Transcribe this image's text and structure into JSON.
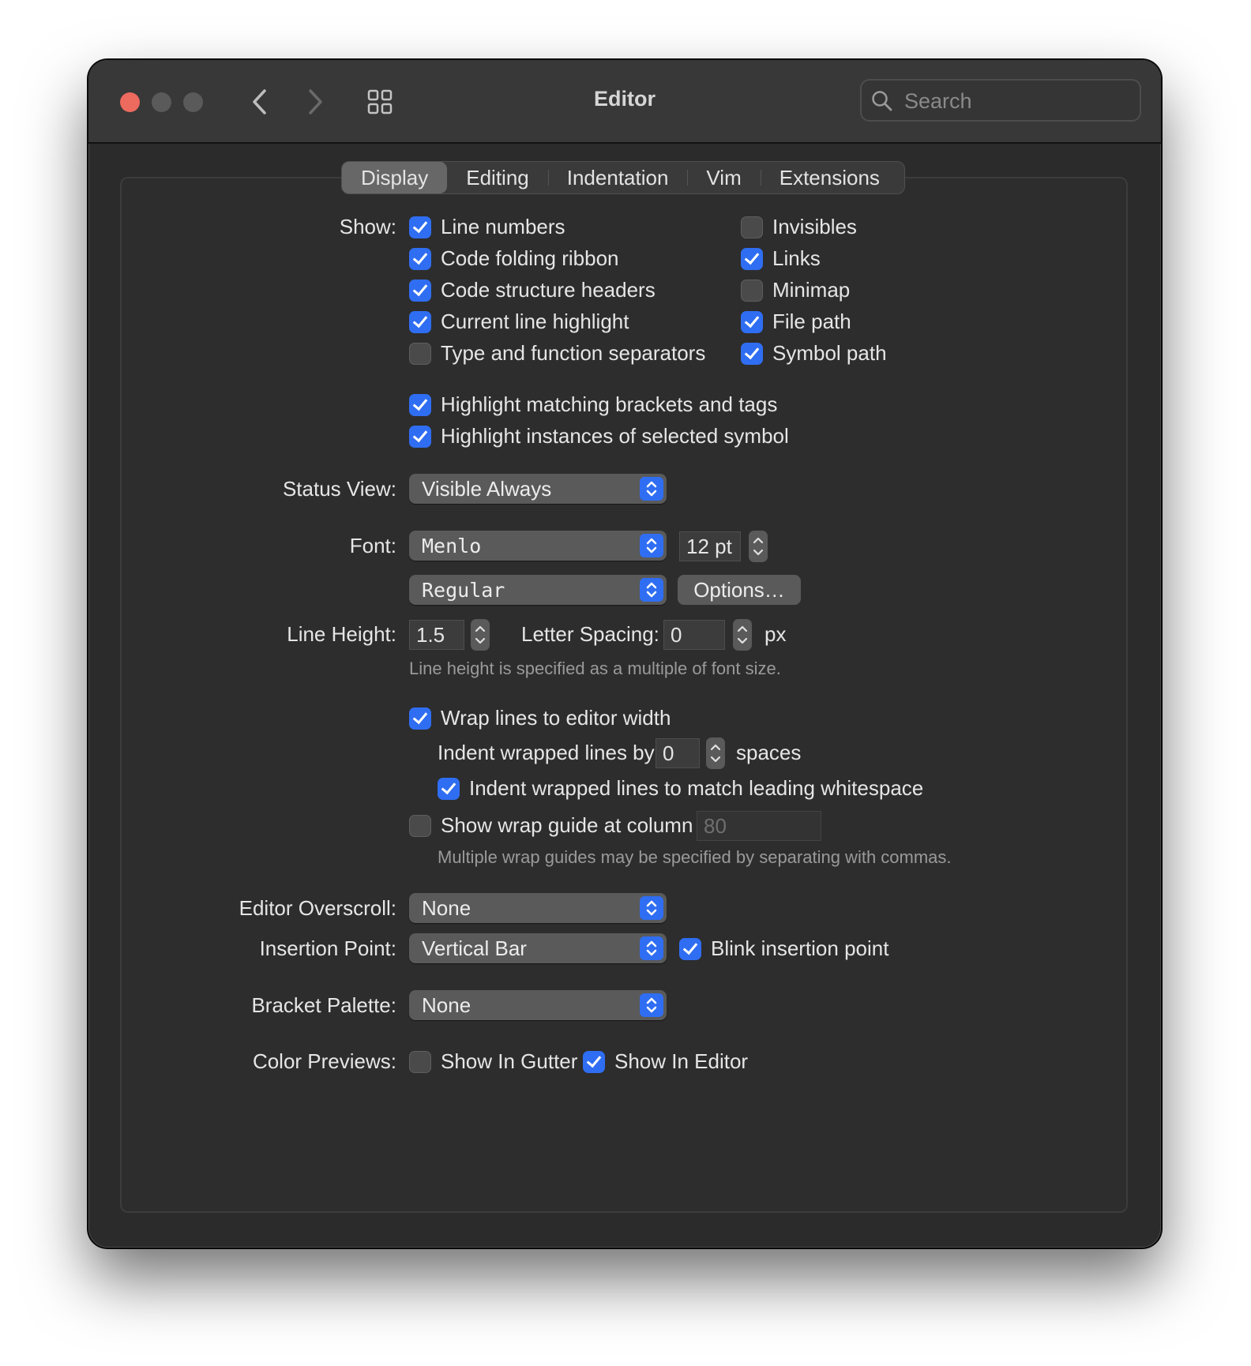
{
  "window": {
    "title": "Editor",
    "search_placeholder": "Search"
  },
  "toolbar": {
    "back_icon": "chevron-left-icon",
    "forward_icon": "chevron-right-icon",
    "grid_icon": "grid-icon"
  },
  "tabs": [
    {
      "label": "Display",
      "active": true
    },
    {
      "label": "Editing",
      "active": false
    },
    {
      "label": "Indentation",
      "active": false
    },
    {
      "label": "Vim",
      "active": false
    },
    {
      "label": "Extensions",
      "active": false
    }
  ],
  "show": {
    "label": "Show:",
    "left": [
      {
        "label": "Line numbers",
        "checked": true
      },
      {
        "label": "Code folding ribbon",
        "checked": true
      },
      {
        "label": "Code structure headers",
        "checked": true
      },
      {
        "label": "Current line highlight",
        "checked": true
      },
      {
        "label": "Type and function separators",
        "checked": false
      }
    ],
    "right": [
      {
        "label": "Invisibles",
        "checked": false
      },
      {
        "label": "Links",
        "checked": true
      },
      {
        "label": "Minimap",
        "checked": false
      },
      {
        "label": "File path",
        "checked": true
      },
      {
        "label": "Symbol path",
        "checked": true
      }
    ]
  },
  "highlight": [
    {
      "label": "Highlight matching brackets and tags",
      "checked": true
    },
    {
      "label": "Highlight instances of selected symbol",
      "checked": true
    }
  ],
  "status_view": {
    "label": "Status View:",
    "value": "Visible Always"
  },
  "font": {
    "label": "Font:",
    "family": "Menlo",
    "size": "12 pt",
    "style": "Regular",
    "options_button": "Options…"
  },
  "line_height": {
    "label": "Line Height:",
    "value": "1.5",
    "letter_spacing_label": "Letter Spacing:",
    "letter_spacing_value": "0",
    "unit": "px",
    "hint": "Line height is specified as a multiple of font size."
  },
  "wrap": {
    "wrap_lines": {
      "label": "Wrap lines to editor width",
      "checked": true
    },
    "indent_label": "Indent wrapped lines by",
    "indent_value": "0",
    "indent_unit": "spaces",
    "indent_match": {
      "label": "Indent wrapped lines to match leading whitespace",
      "checked": true
    },
    "wrap_guide": {
      "label": "Show wrap guide at column",
      "checked": false
    },
    "wrap_guide_value": "80",
    "hint": "Multiple wrap guides may be specified by separating with commas."
  },
  "overscroll": {
    "label": "Editor Overscroll:",
    "value": "None"
  },
  "insertion": {
    "label": "Insertion Point:",
    "value": "Vertical Bar",
    "blink": {
      "label": "Blink insertion point",
      "checked": true
    }
  },
  "bracket": {
    "label": "Bracket Palette:",
    "value": "None"
  },
  "color_previews": {
    "label": "Color Previews:",
    "gutter": {
      "label": "Show In Gutter",
      "checked": false
    },
    "editor": {
      "label": "Show In Editor",
      "checked": true
    }
  },
  "colors": {
    "accent": "#2f6ef2",
    "close": "#ed6a5e"
  }
}
